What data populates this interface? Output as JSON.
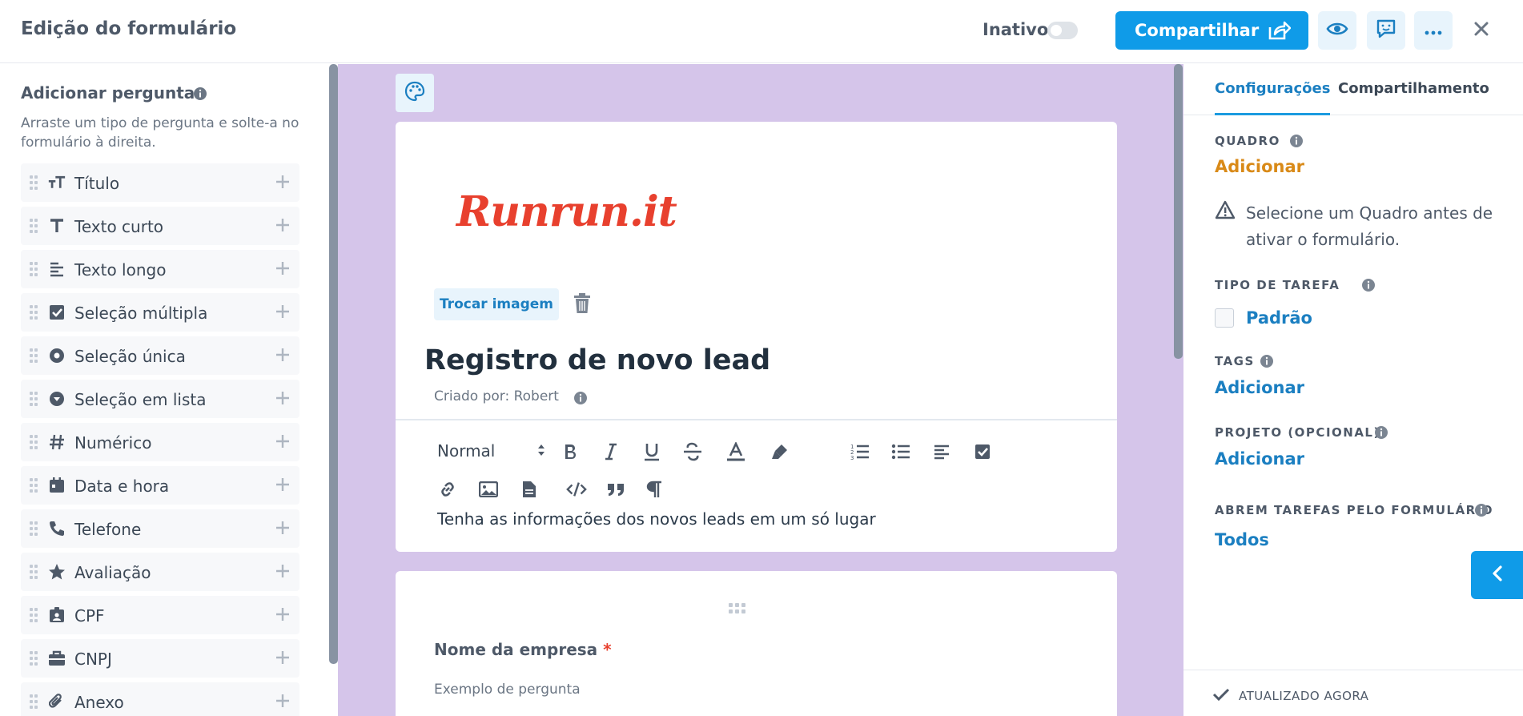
{
  "header": {
    "title": "Edição do formulário",
    "status_label": "Inativo",
    "share_label": "Compartilhar"
  },
  "left_panel": {
    "title": "Adicionar pergunta",
    "description": "Arraste um tipo de pergunta e solte-a no formulário à direita.",
    "items": [
      {
        "label": "Título",
        "icon": "title-icon"
      },
      {
        "label": "Texto curto",
        "icon": "text-icon"
      },
      {
        "label": "Texto longo",
        "icon": "paragraph-lines-icon"
      },
      {
        "label": "Seleção múltipla",
        "icon": "checkbox-icon"
      },
      {
        "label": "Seleção única",
        "icon": "radio-icon"
      },
      {
        "label": "Seleção em lista",
        "icon": "dropdown-icon"
      },
      {
        "label": "Numérico",
        "icon": "hash-icon"
      },
      {
        "label": "Data e hora",
        "icon": "calendar-icon"
      },
      {
        "label": "Telefone",
        "icon": "phone-icon"
      },
      {
        "label": "Avaliação",
        "icon": "star-icon"
      },
      {
        "label": "CPF",
        "icon": "id-card-icon"
      },
      {
        "label": "CNPJ",
        "icon": "briefcase-icon"
      },
      {
        "label": "Anexo",
        "icon": "paperclip-icon"
      }
    ]
  },
  "form": {
    "logo_text": "Runrun.it",
    "swap_image_label": "Trocar imagem",
    "title": "Registro de novo lead",
    "created_by": "Criado por: Robert",
    "toolbar_style": "Normal",
    "description_text": "Tenha as informações dos novos leads em um só lugar",
    "question": {
      "name": "Nome da empresa",
      "required_mark": "*",
      "hint": "Exemplo de pergunta"
    }
  },
  "right_panel": {
    "tabs": [
      "Configurações",
      "Compartilhamento"
    ],
    "quadro_label": "QUADRO",
    "quadro_value": "Adicionar",
    "warning": "Selecione um Quadro antes de ativar o formulário.",
    "tipo_label": "TIPO DE TAREFA",
    "tipo_value": "Padrão",
    "tags_label": "TAGS",
    "tags_value": "Adicionar",
    "projeto_label": "PROJETO (OPCIONAL)",
    "projeto_value": "Adicionar",
    "abrem_label": "ABREM TAREFAS PELO FORMULÁRIO",
    "abrem_value": "Todos",
    "updated": "ATUALIZADO AGORA"
  },
  "colors": {
    "accent": "#0f9be8",
    "link": "#1b7fc1",
    "orange": "#d98a18",
    "canvas_bg": "#d5c5ea",
    "logo": "#e8402e"
  }
}
